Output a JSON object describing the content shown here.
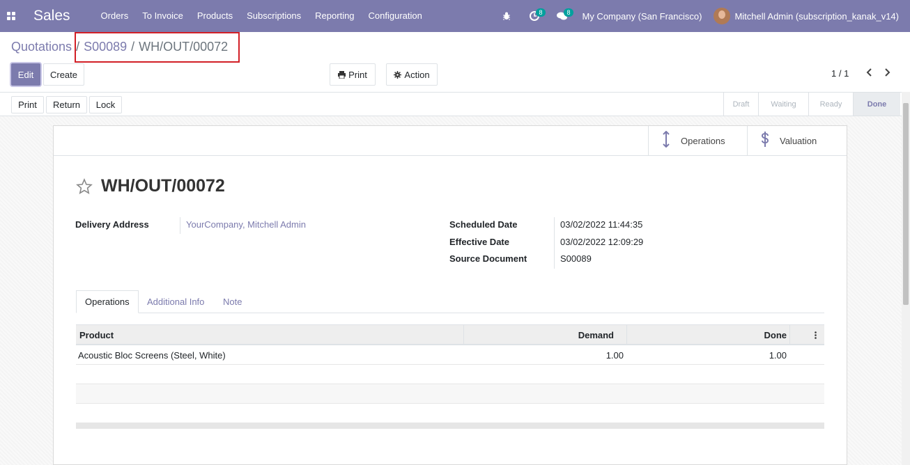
{
  "navbar": {
    "app_name": "Sales",
    "menu": [
      "Orders",
      "To Invoice",
      "Products",
      "Subscriptions",
      "Reporting",
      "Configuration"
    ],
    "activities_count": "8",
    "messages_count": "8",
    "company": "My Company (San Francisco)",
    "user": "Mitchell Admin (subscription_kanak_v14)"
  },
  "breadcrumb": {
    "root": "Quotations",
    "sep1": "/",
    "middle": "S00089",
    "sep2": "/",
    "current": "WH/OUT/00072"
  },
  "control": {
    "edit": "Edit",
    "create": "Create",
    "print": "Print",
    "action": "Action",
    "pager": "1 / 1"
  },
  "status_buttons": {
    "print": "Print",
    "return": "Return",
    "lock": "Lock"
  },
  "stages": [
    "Draft",
    "Waiting",
    "Ready",
    "Done"
  ],
  "current_stage": "Done",
  "smart_buttons": {
    "operations": "Operations",
    "valuation": "Valuation"
  },
  "record": {
    "name": "WH/OUT/00072",
    "delivery_address_label": "Delivery Address",
    "delivery_address": "YourCompany, Mitchell Admin",
    "scheduled_date_label": "Scheduled Date",
    "scheduled_date": "03/02/2022 11:44:35",
    "effective_date_label": "Effective Date",
    "effective_date": "03/02/2022 12:09:29",
    "source_document_label": "Source Document",
    "source_document": "S00089"
  },
  "tabs": [
    "Operations",
    "Additional Info",
    "Note"
  ],
  "table": {
    "headers": {
      "product": "Product",
      "demand": "Demand",
      "done": "Done"
    },
    "rows": [
      {
        "product": "Acoustic Bloc Screens (Steel, White)",
        "demand": "1.00",
        "done": "1.00"
      }
    ]
  },
  "colors": {
    "brand": "#7c7bad",
    "badge": "#00a09d",
    "highlight": "#d21f26"
  }
}
